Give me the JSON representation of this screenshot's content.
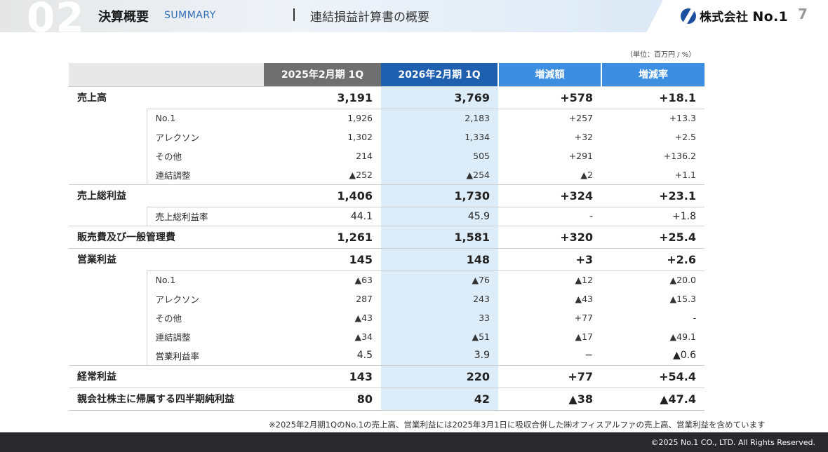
{
  "header": {
    "section_number": "02",
    "section_title": "決算概要",
    "section_subtitle": "SUMMARY",
    "topic": "連結損益計算書の概要",
    "logo_text_prefix": "株式会社",
    "logo_text_suffix": "No.1",
    "page_number": "7"
  },
  "unit_note": "（単位：百万円 / %）",
  "table": {
    "columns": [
      "2025年2月期 1Q",
      "2026年2月期 1Q",
      "増減額",
      "増減率"
    ],
    "rows": [
      {
        "type": "major",
        "label": "売上高",
        "values": [
          "3,191",
          "3,769",
          "+578",
          "+18.1"
        ]
      },
      {
        "type": "sub",
        "label": "No.1",
        "values": [
          "1,926",
          "2,183",
          "+257",
          "+13.3"
        ]
      },
      {
        "type": "sub",
        "label": "アレクソン",
        "values": [
          "1,302",
          "1,334",
          "+32",
          "+2.5"
        ]
      },
      {
        "type": "sub",
        "label": "その他",
        "values": [
          "214",
          "505",
          "+291",
          "+136.2"
        ]
      },
      {
        "type": "sub",
        "label": "連結調整",
        "values": [
          "▲252",
          "▲254",
          "▲2",
          "+1.1"
        ]
      },
      {
        "type": "major",
        "label": "売上総利益",
        "values": [
          "1,406",
          "1,730",
          "+324",
          "+23.1"
        ]
      },
      {
        "type": "rate",
        "label": "売上総利益率",
        "values": [
          "44.1",
          "45.9",
          "-",
          "+1.8"
        ]
      },
      {
        "type": "major",
        "label": "販売費及び一般管理費",
        "values": [
          "1,261",
          "1,581",
          "+320",
          "+25.4"
        ]
      },
      {
        "type": "major",
        "label": "営業利益",
        "values": [
          "145",
          "148",
          "+3",
          "+2.6"
        ]
      },
      {
        "type": "sub",
        "label": "No.1",
        "values": [
          "▲63",
          "▲76",
          "▲12",
          "▲20.0"
        ]
      },
      {
        "type": "sub",
        "label": "アレクソン",
        "values": [
          "287",
          "243",
          "▲43",
          "▲15.3"
        ]
      },
      {
        "type": "sub",
        "label": "その他",
        "values": [
          "▲43",
          "33",
          "+77",
          "-"
        ]
      },
      {
        "type": "sub",
        "label": "連結調整",
        "values": [
          "▲34",
          "▲51",
          "▲17",
          "▲49.1"
        ]
      },
      {
        "type": "rate",
        "label": "営業利益率",
        "values": [
          "4.5",
          "3.9",
          "−",
          "▲0.6"
        ]
      },
      {
        "type": "major",
        "label": "経常利益",
        "values": [
          "143",
          "220",
          "+77",
          "+54.4"
        ]
      },
      {
        "type": "major",
        "label": "親会社株主に帰属する四半期純利益",
        "values": [
          "80",
          "42",
          "▲38",
          "▲47.4"
        ]
      }
    ]
  },
  "footnote": "※2025年2月期1QのNo.1の売上高、営業利益には2025年3月1日に吸収合併した㈱オフィスアルファの売上高、営業利益を含めています",
  "footer": {
    "copyright": "©2025 No.1 CO., LTD. All Rights Reserved."
  }
}
